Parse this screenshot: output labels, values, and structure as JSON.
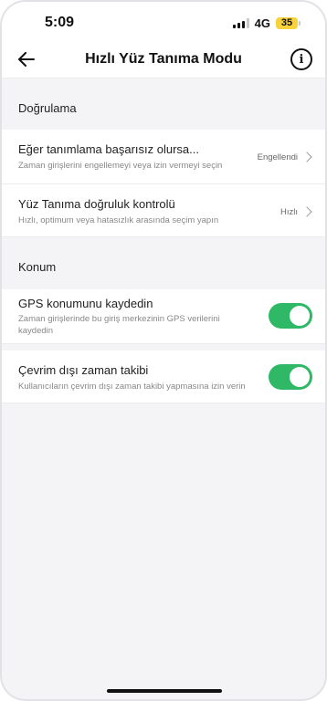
{
  "status_bar": {
    "time": "5:09",
    "network": "4G",
    "battery": "35"
  },
  "header": {
    "title": "Hızlı Yüz Tanıma Modu",
    "back_icon": "arrow-left-icon",
    "info_icon": "info-icon",
    "info_glyph": "i"
  },
  "sections": {
    "verification": {
      "header": "Doğrulama",
      "rows": [
        {
          "title": "Eğer tanımlama başarısız olursa...",
          "subtitle": "Zaman girişlerini engellemeyi veya izin vermeyi seçin",
          "value": "Engellendi"
        },
        {
          "title": "Yüz Tanıma doğruluk kontrolü",
          "subtitle": "Hızlı, optimum veya hatasızlık arasında seçim yapın",
          "value": "Hızlı"
        }
      ]
    },
    "location": {
      "header": "Konum",
      "rows": [
        {
          "title": "GPS konumunu kaydedin",
          "subtitle": "Zaman girişlerinde bu giriş merkezinin GPS verilerini kaydedin",
          "enabled": true
        },
        {
          "title": "Çevrim dışı zaman takibi",
          "subtitle": "Kullanıcıların çevrim dışı zaman takibi yapmasına izin verin",
          "enabled": true
        }
      ]
    }
  },
  "colors": {
    "toggle_on": "#2fb967",
    "battery": "#f7d23c",
    "background": "#f4f4f6"
  }
}
